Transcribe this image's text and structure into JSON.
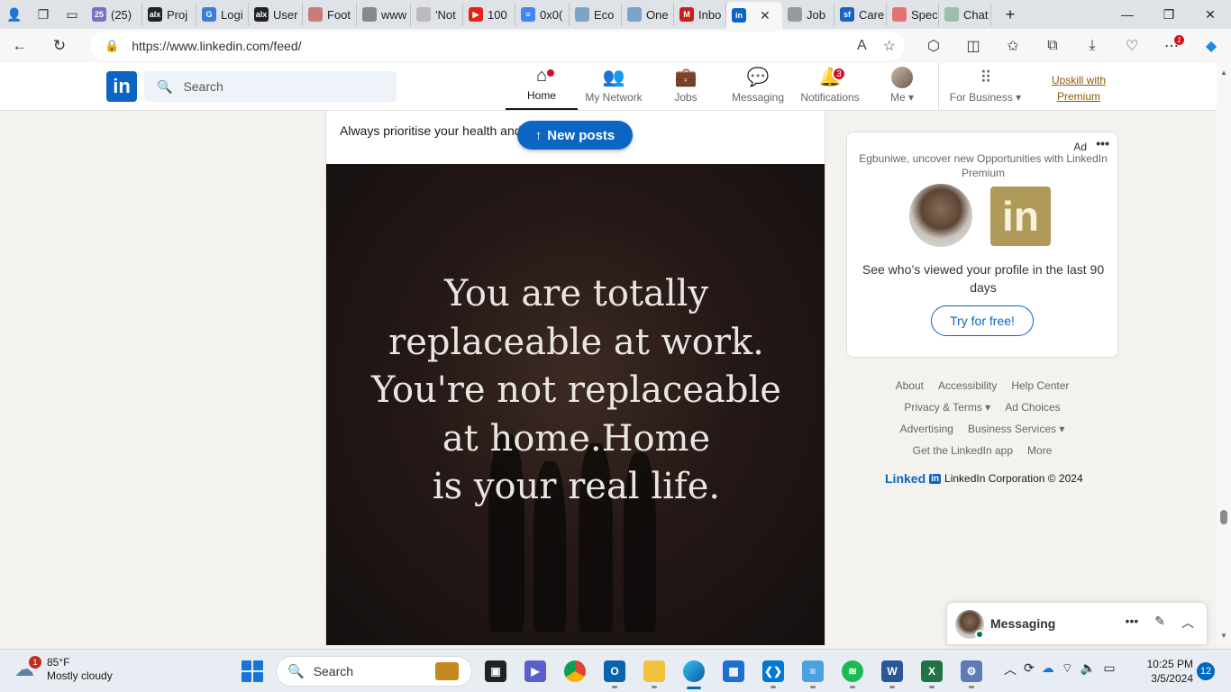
{
  "browser": {
    "tabs": [
      {
        "label": "(25)",
        "fav_color": "#7b6fc4",
        "fav_text": "25"
      },
      {
        "label": "Proj",
        "fav_color": "#222222",
        "fav_text": "alx"
      },
      {
        "label": "Logi",
        "fav_color": "#3b7dd8",
        "fav_text": "G"
      },
      {
        "label": "User",
        "fav_color": "#222222",
        "fav_text": "alx"
      },
      {
        "label": "Foot",
        "fav_color": "#c97b7b",
        "fav_text": ""
      },
      {
        "label": "www",
        "fav_color": "#888888",
        "fav_text": ""
      },
      {
        "label": "'Not",
        "fav_color": "#bbbbbb",
        "fav_text": ""
      },
      {
        "label": "100",
        "fav_color": "#e62117",
        "fav_text": "▶"
      },
      {
        "label": "0x0(",
        "fav_color": "#4285f4",
        "fav_text": "≡"
      },
      {
        "label": "Eco",
        "fav_color": "#7da3c9",
        "fav_text": ""
      },
      {
        "label": "One",
        "fav_color": "#7da3c9",
        "fav_text": ""
      },
      {
        "label": "Inbo",
        "fav_color": "#c5221f",
        "fav_text": "M"
      }
    ],
    "active_tab": {
      "label": "",
      "fav_color": "#0a66c2",
      "fav_text": "in"
    },
    "tabs_after": [
      {
        "label": "Job",
        "fav_color": "#999999",
        "fav_text": ""
      },
      {
        "label": "Care",
        "fav_color": "#1565c0",
        "fav_text": "sf"
      },
      {
        "label": "Spec",
        "fav_color": "#e57373",
        "fav_text": ""
      },
      {
        "label": "Chat",
        "fav_color": "#9bbfab",
        "fav_text": ""
      }
    ],
    "new_tab": "+",
    "url": "https://www.linkedin.com/feed/",
    "downloads_badge": "1"
  },
  "linkedin": {
    "logo": "in",
    "search_placeholder": "Search",
    "nav": [
      {
        "label": "Home",
        "icon": "home-icon",
        "glyph": "⌂",
        "badge": "",
        "dot": true,
        "active": true
      },
      {
        "label": "My Network",
        "icon": "network-icon",
        "glyph": "👥",
        "badge": "",
        "dot": false
      },
      {
        "label": "Jobs",
        "icon": "briefcase-icon",
        "glyph": "💼",
        "badge": "",
        "dot": false
      },
      {
        "label": "Messaging",
        "icon": "chat-icon",
        "glyph": "💬",
        "badge": "",
        "dot": false
      },
      {
        "label": "Notifications",
        "icon": "bell-icon",
        "glyph": "🔔",
        "badge": "3",
        "dot": false
      }
    ],
    "me_label": "Me",
    "for_business": "For Business",
    "upskill": "Upskill with Premium"
  },
  "feed": {
    "post_text": "Always prioritise your health and",
    "new_posts": "New posts",
    "image_quote": [
      "You are totally",
      "replaceable at work.",
      "You're not replaceable",
      "at home.Home",
      "is your real life."
    ]
  },
  "ad": {
    "label": "Ad",
    "headline": "Egbuniwe, uncover new Opportunities with LinkedIn Premium",
    "logo": "in",
    "description": "See who’s viewed your profile in the last 90 days",
    "cta": "Try for free!"
  },
  "footer": {
    "rows": [
      [
        "About",
        "Accessibility",
        "Help Center"
      ],
      [
        "Privacy & Terms ▾",
        "Ad Choices"
      ],
      [
        "Advertising",
        "Business Services ▾"
      ],
      [
        "Get the LinkedIn app",
        "More"
      ]
    ],
    "brand": "Linked",
    "brand_box": "in",
    "copyright": "LinkedIn Corporation © 2024"
  },
  "messaging": {
    "title": "Messaging"
  },
  "taskbar": {
    "weather_temp": "85°F",
    "weather_desc": "Mostly cloudy",
    "weather_badge": "1",
    "search_placeholder": "Search",
    "time": "10:25 PM",
    "date": "3/5/2024",
    "notifications": "12"
  }
}
